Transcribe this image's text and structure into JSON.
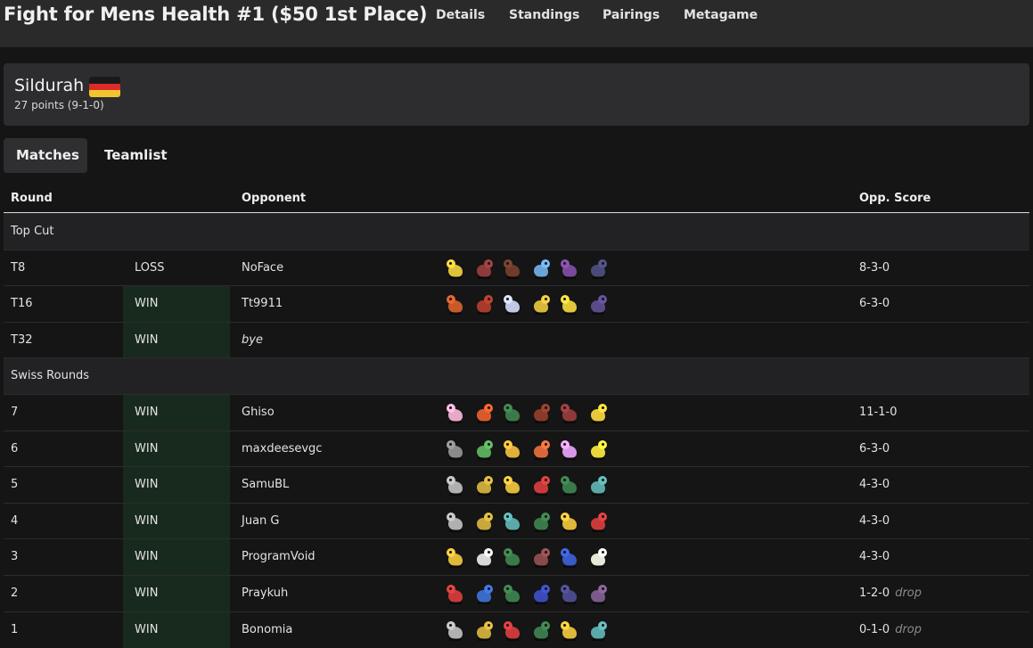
{
  "header": {
    "title": "Fight for Mens Health #1 ($50 1st Place)",
    "nav": [
      {
        "label": "Details"
      },
      {
        "label": "Standings"
      },
      {
        "label": "Pairings"
      },
      {
        "label": "Metagame"
      }
    ]
  },
  "player": {
    "name": "Sildurah",
    "flag_icon": "germany-flag-icon",
    "flag_colors": [
      "#1a1a1a",
      "#dd2a2a",
      "#f2c430"
    ],
    "points": "27 points (9-1-0)"
  },
  "tabs": [
    {
      "label": "Matches",
      "active": true
    },
    {
      "label": "Teamlist",
      "active": false
    }
  ],
  "table": {
    "headers": {
      "round": "Round",
      "opponent": "Opponent",
      "opp_score": "Opp. Score"
    },
    "sections": [
      {
        "label": "Top Cut",
        "rows": [
          {
            "round": "T8",
            "result": "LOSS",
            "opponent": "NoFace",
            "opp_score": "8-3-0",
            "drop": "",
            "team": [
              "#e0c23a",
              "#8f3a3a",
              "#6e3b2c",
              "#6aa3d8",
              "#7a4a9a",
              "#4a4a78"
            ]
          },
          {
            "round": "T16",
            "result": "WIN",
            "opponent": "Tt9911",
            "opp_score": "6-3-0",
            "drop": "",
            "team": [
              "#c85a2a",
              "#a83a2a",
              "#c0c8e8",
              "#d8b83a",
              "#e0c83a",
              "#5a4a8a"
            ]
          },
          {
            "round": "T32",
            "result": "WIN",
            "opponent": "bye",
            "opp_score": "",
            "drop": "",
            "team": []
          }
        ]
      },
      {
        "label": "Swiss Rounds",
        "rows": [
          {
            "round": "7",
            "result": "WIN",
            "opponent": "Ghiso",
            "opp_score": "11-1-0",
            "drop": "",
            "team": [
              "#e8a8c8",
              "#d85a2a",
              "#3a7a4a",
              "#8a3a2a",
              "#8f3a3a",
              "#e8c83a"
            ]
          },
          {
            "round": "6",
            "result": "WIN",
            "opponent": "maxdeesevgc",
            "opp_score": "6-3-0",
            "drop": "",
            "team": [
              "#8a8a8a",
              "#5aa85a",
              "#e0b03a",
              "#d8683a",
              "#d898e8",
              "#e8d83a"
            ]
          },
          {
            "round": "5",
            "result": "WIN",
            "opponent": "SamuBL",
            "opp_score": "4-3-0",
            "drop": "",
            "team": [
              "#b0b0b0",
              "#c8a83a",
              "#e0b83a",
              "#c83a3a",
              "#3a7a4a",
              "#5aa8a8"
            ]
          },
          {
            "round": "4",
            "result": "WIN",
            "opponent": "Juan G",
            "opp_score": "4-3-0",
            "drop": "",
            "team": [
              "#b0b0b0",
              "#c8a83a",
              "#5aa8a8",
              "#3a7a4a",
              "#e0b83a",
              "#c83a3a"
            ]
          },
          {
            "round": "3",
            "result": "WIN",
            "opponent": "ProgramVoid",
            "opp_score": "4-3-0",
            "drop": "",
            "team": [
              "#e0b83a",
              "#d8d8d8",
              "#3a7a4a",
              "#8a4a4a",
              "#3a5ac8",
              "#e8e8d8"
            ]
          },
          {
            "round": "2",
            "result": "WIN",
            "opponent": "Praykuh",
            "opp_score": "1-2-0",
            "drop": "drop",
            "team": [
              "#c83a3a",
              "#3a6ac8",
              "#3a7a4a",
              "#3a4ab8",
              "#4a4a8a",
              "#7a5a8a"
            ]
          },
          {
            "round": "1",
            "result": "WIN",
            "opponent": "Bonomia",
            "opp_score": "0-1-0",
            "drop": "drop",
            "team": [
              "#b0b0b0",
              "#c8a83a",
              "#c83a3a",
              "#3a7a4a",
              "#e0b83a",
              "#5aa8a8"
            ]
          }
        ]
      }
    ]
  }
}
